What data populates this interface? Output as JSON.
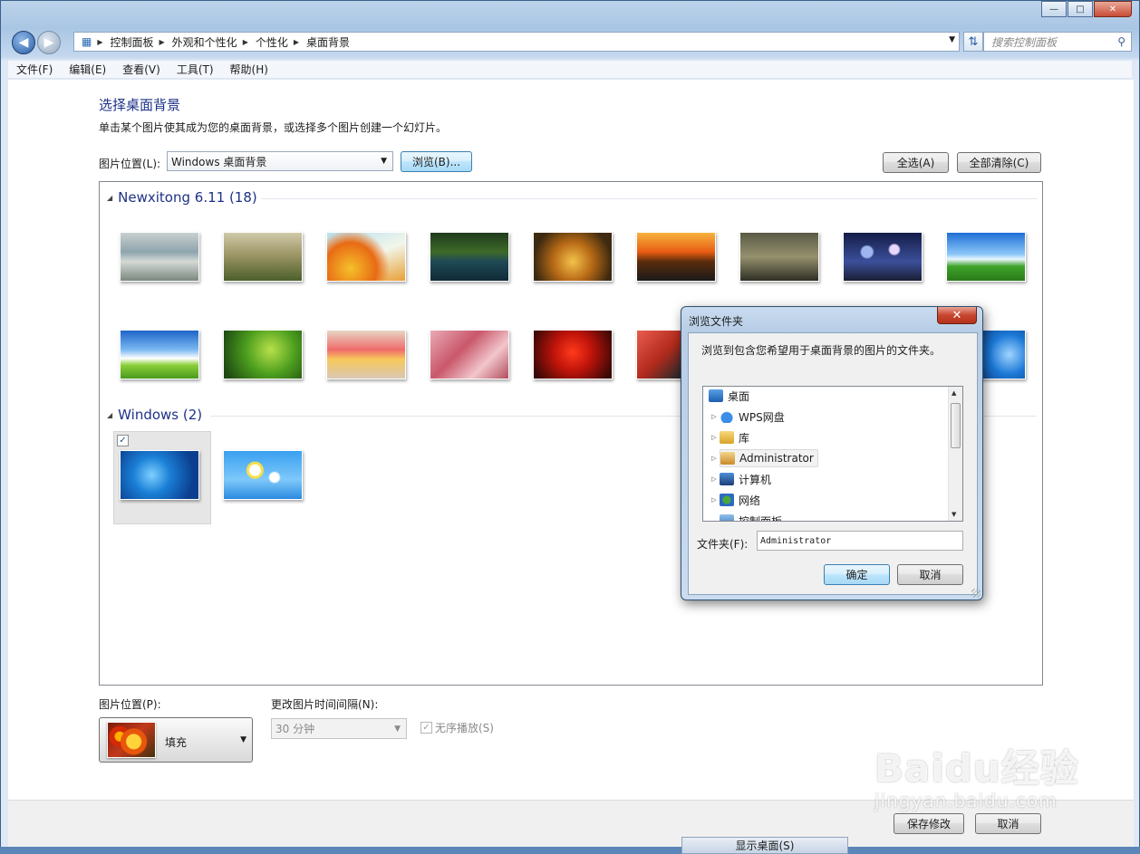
{
  "window": {
    "controls": {
      "minimize": "—",
      "maximize": "□",
      "close": "✕"
    }
  },
  "address": {
    "back_icon": "back-arrow-icon",
    "forward_icon": "forward-arrow-icon",
    "crumbs": [
      "控制面板",
      "外观和个性化",
      "个性化",
      "桌面背景"
    ],
    "search_placeholder": "搜索控制面板"
  },
  "menu": [
    "文件(F)",
    "编辑(E)",
    "查看(V)",
    "工具(T)",
    "帮助(H)"
  ],
  "page": {
    "title": "选择桌面背景",
    "subtitle": "单击某个图片使其成为您的桌面背景，或选择多个图片创建一个幻灯片。",
    "location_label": "图片位置(L):",
    "location_value": "Windows 桌面背景",
    "browse_button": "浏览(B)...",
    "select_all_button": "全选(A)",
    "clear_all_button": "全部清除(C)"
  },
  "gallery": {
    "groups": [
      {
        "name": "Newxitong 6.11 (18)"
      },
      {
        "name": "Windows (2)"
      }
    ]
  },
  "options": {
    "position_label": "图片位置(P):",
    "position_value": "填充",
    "interval_label": "更改图片时间间隔(N):",
    "interval_value": "30 分钟",
    "shuffle_label": "无序播放(S)"
  },
  "footer": {
    "save_button": "保存修改",
    "cancel_button": "取消",
    "show_desktop": "显示桌面(S)"
  },
  "dialog": {
    "title": "浏览文件夹",
    "description": "浏览到包含您希望用于桌面背景的图片的文件夹。",
    "tree": [
      {
        "label": "桌面",
        "icon": "desktop-icon"
      },
      {
        "label": "WPS网盘",
        "icon": "cloud-icon"
      },
      {
        "label": "库",
        "icon": "library-icon"
      },
      {
        "label": "Administrator",
        "icon": "user-folder-icon"
      },
      {
        "label": "计算机",
        "icon": "computer-icon"
      },
      {
        "label": "网络",
        "icon": "network-icon"
      },
      {
        "label": "控制面板",
        "icon": "control-panel-icon"
      }
    ],
    "folder_label": "文件夹(F):",
    "folder_value": "Administrator",
    "ok_button": "确定",
    "cancel_button": "取消"
  },
  "watermark": {
    "text": "Baidu经验",
    "sub": "jingyan.baidu.com"
  }
}
